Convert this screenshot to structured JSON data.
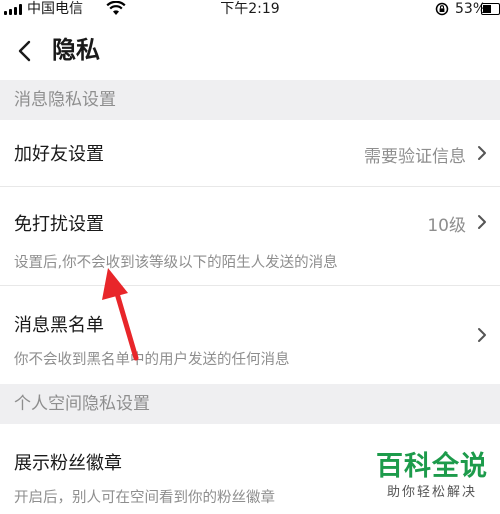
{
  "status_bar": {
    "carrier": "中国电信",
    "time": "下午2:19",
    "battery_percent": "53%"
  },
  "nav": {
    "title": "隐私"
  },
  "sections": {
    "message_privacy": "消息隐私设置",
    "space_privacy": "个人空间隐私设置"
  },
  "rows": {
    "add_friend": {
      "label": "加好友设置",
      "value": "需要验证信息"
    },
    "do_not_disturb": {
      "label": "免打扰设置",
      "value": "10级",
      "description": "设置后,你不会收到该等级以下的陌生人发送的消息"
    },
    "blacklist": {
      "label": "消息黑名单",
      "description": "你不会收到黑名单中的用户发送的任何消息"
    },
    "fan_badge": {
      "label": "展示粉丝徽章",
      "description": "开启后，别人可在空间看到你的粉丝徽章"
    }
  },
  "watermark": {
    "brand": "百科全说",
    "slogan": "助你轻松解决"
  },
  "colors": {
    "section_bg": "#efeff1",
    "muted_text": "#8e8e8e",
    "annotation_arrow": "#e8262a",
    "watermark_green": "#1d9b4b"
  }
}
